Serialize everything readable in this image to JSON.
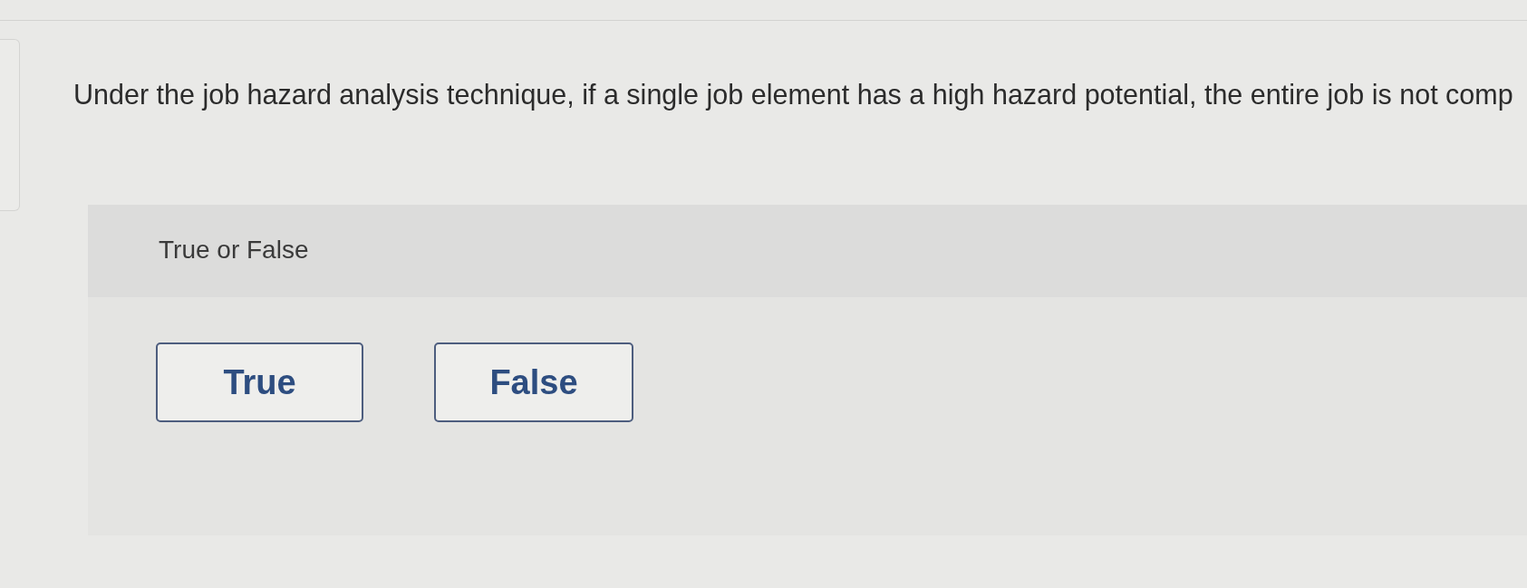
{
  "question": {
    "text": "Under the job hazard analysis technique, if a single job element has a high hazard potential, the entire job is not comp"
  },
  "prompt": {
    "label": "True or False"
  },
  "options": [
    {
      "label": "True",
      "selected": false
    },
    {
      "label": "False",
      "selected": false
    }
  ]
}
